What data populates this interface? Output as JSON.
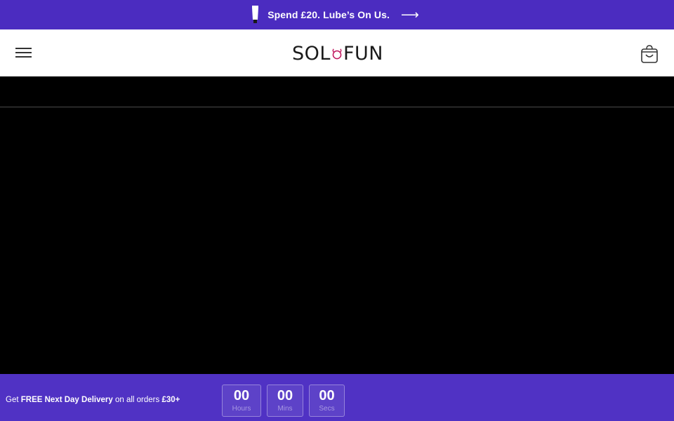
{
  "announcement": {
    "text": "Spend £20. Lube’s On Us.",
    "arrow": "⟶",
    "icon": "lube-tube-icon",
    "bg_color": "#4b2cc0"
  },
  "header": {
    "logo_left": "SOL",
    "logo_right": "FUN",
    "logo_ring_color": "#c0175d",
    "menu_icon": "hamburger-menu-icon",
    "cart_icon": "shopping-bag-icon"
  },
  "promo": {
    "prefix": "Get ",
    "bold1": "FREE Next Day Delivery",
    "middle": " on all orders ",
    "bold2": "£30+",
    "bg_color": "#5032c4"
  },
  "countdown": [
    {
      "value": "00",
      "label": "Hours"
    },
    {
      "value": "00",
      "label": "Mins"
    },
    {
      "value": "00",
      "label": "Secs"
    }
  ]
}
